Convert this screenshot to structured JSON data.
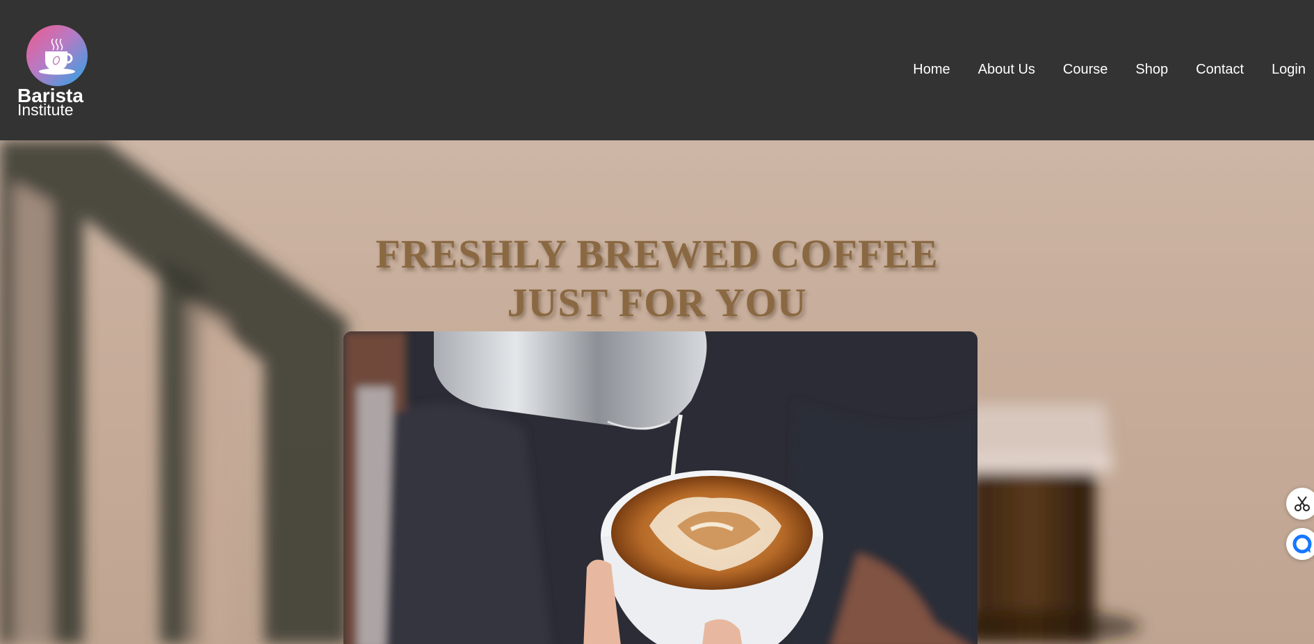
{
  "brand": {
    "name_line1": "Barista",
    "name_line2": "Institute",
    "logo_icon": "coffee-cup-icon",
    "gradient": [
      "#f05a8c",
      "#2aa4e6"
    ]
  },
  "nav": {
    "items": [
      {
        "label": "Home"
      },
      {
        "label": "About Us"
      },
      {
        "label": "Course"
      },
      {
        "label": "Shop"
      },
      {
        "label": "Contact"
      },
      {
        "label": "Login"
      }
    ]
  },
  "hero": {
    "title_line1": "FRESHLY BREWED COFFEE",
    "title_line2": "JUST FOR YOU",
    "title_color": "#8a6942",
    "image": "latte-art-pour-photo"
  },
  "side_tools": [
    {
      "icon": "scissors-icon"
    },
    {
      "icon": "chat-bubble-icon",
      "color": "#1677ff"
    }
  ],
  "colors": {
    "header_bg": "#333333",
    "hero_bg": "#c9b09e"
  }
}
